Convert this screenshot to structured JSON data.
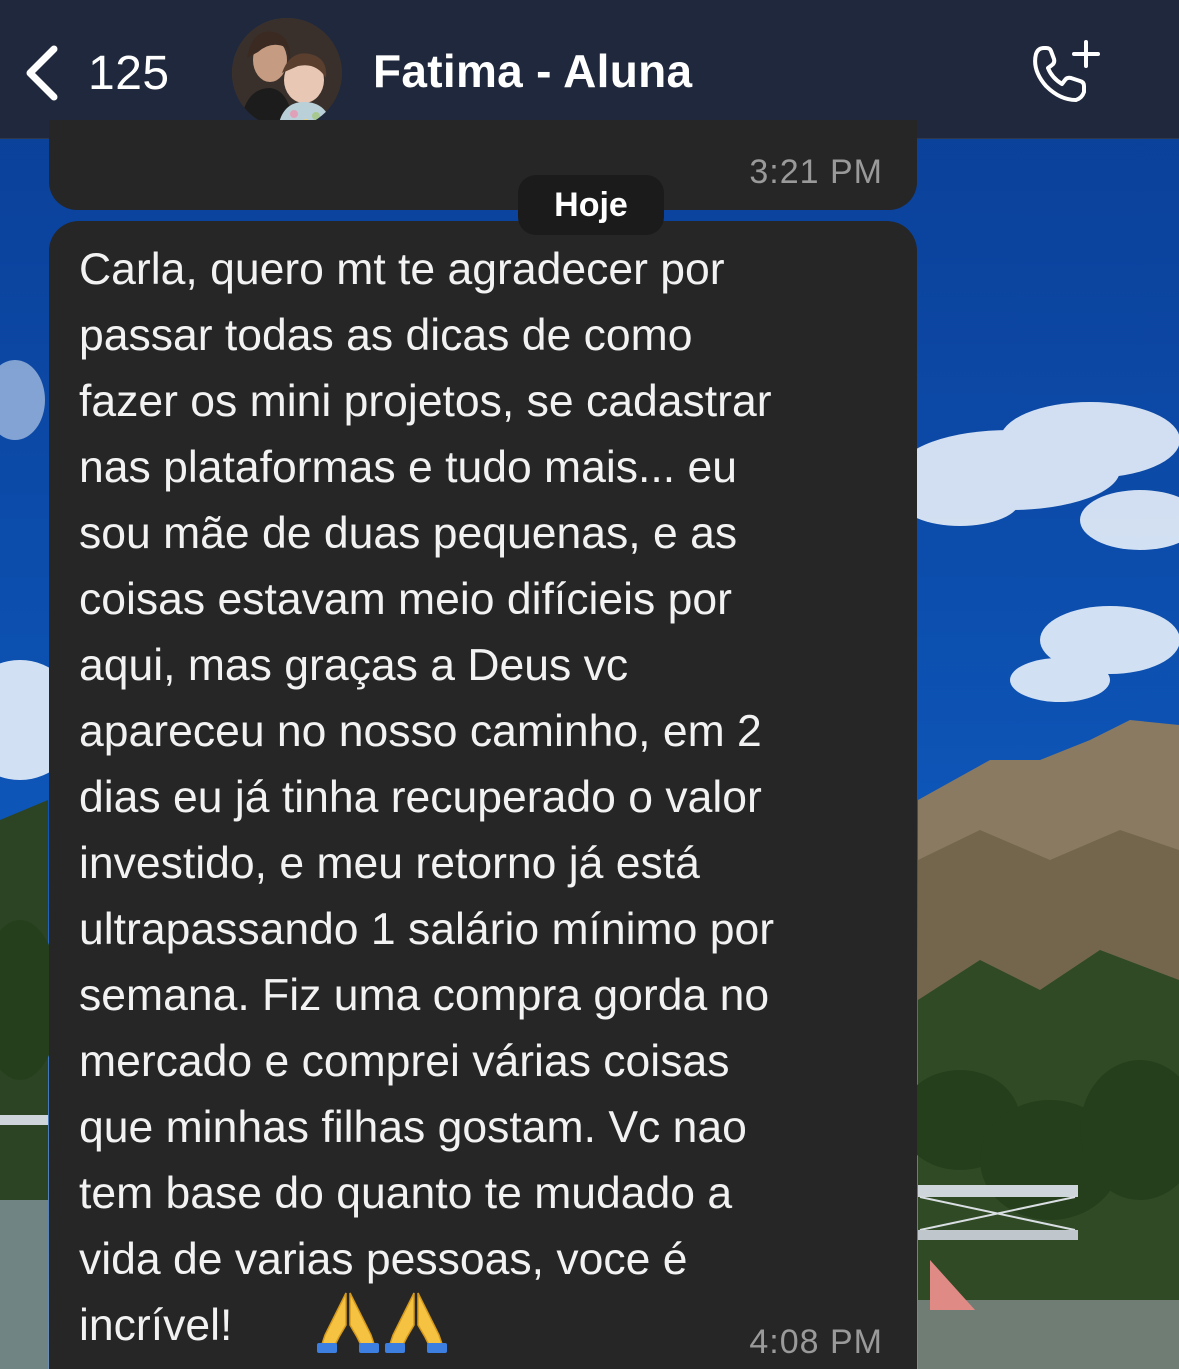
{
  "header": {
    "back_count": "125",
    "contact_name": "Fatima - Aluna",
    "avatar_icon": "contact-photo",
    "call_icon": "phone-add-icon"
  },
  "chat": {
    "previous_message": {
      "time": "3:21 PM"
    },
    "date_separator": "Hoje",
    "message": {
      "text": "Carla, quero mt te agradecer por\npassar todas as dicas de como\nfazer os mini projetos, se cadastrar\nnas plataformas e tudo mais... eu\nsou mãe de duas pequenas, e as\ncoisas estavam meio difícieis por\naqui, mas graças a Deus vc\napareceu no nosso caminho, em 2\ndias eu já tinha recuperado o valor\ninvestido, e meu retorno já está\nultrapassando 1 salário mínimo por\nsemana. Fiz uma compra gorda no\nmercado e comprei várias coisas\nque minhas filhas gostam. Vc nao\ntem base do quanto te mudado a\nvida de varias pessoas, voce é\nincrível!",
      "emoji_icons": [
        "folded-hands-icon",
        "folded-hands-icon"
      ],
      "time": "4:08 PM"
    }
  },
  "colors": {
    "bubble": "#262626",
    "topbar": "#202838",
    "timestamp": "#9a9a9a",
    "sky": "#0c4aa8"
  }
}
